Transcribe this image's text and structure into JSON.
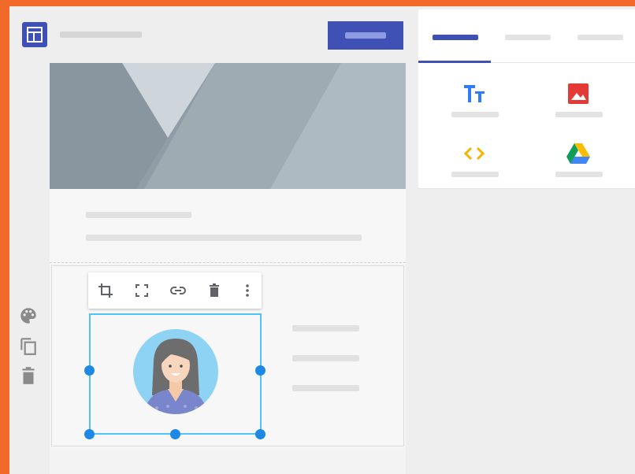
{
  "header": {
    "logo_icon": "layout-icon",
    "title_placeholder": "",
    "publish_label": ""
  },
  "colors": {
    "accent": "#3f51b5",
    "frame": "#f26a2a",
    "selection": "#4fc3f7",
    "handle": "#1e88e5"
  },
  "image_toolbar": {
    "tools": [
      {
        "icon": "crop-icon"
      },
      {
        "icon": "fullscreen-icon"
      },
      {
        "icon": "link-icon"
      },
      {
        "icon": "delete-icon"
      },
      {
        "icon": "more-vert-icon"
      }
    ]
  },
  "left_tools": [
    {
      "icon": "palette-icon"
    },
    {
      "icon": "copy-icon"
    },
    {
      "icon": "delete-icon"
    }
  ],
  "right_panel": {
    "tabs": [
      {
        "label": "",
        "active": true
      },
      {
        "label": "",
        "active": false
      },
      {
        "label": "",
        "active": false
      }
    ],
    "insert_items": [
      {
        "icon": "text-box-icon",
        "label": ""
      },
      {
        "icon": "image-icon",
        "label": ""
      },
      {
        "icon": "embed-code-icon",
        "label": ""
      },
      {
        "icon": "google-drive-icon",
        "label": ""
      }
    ]
  }
}
